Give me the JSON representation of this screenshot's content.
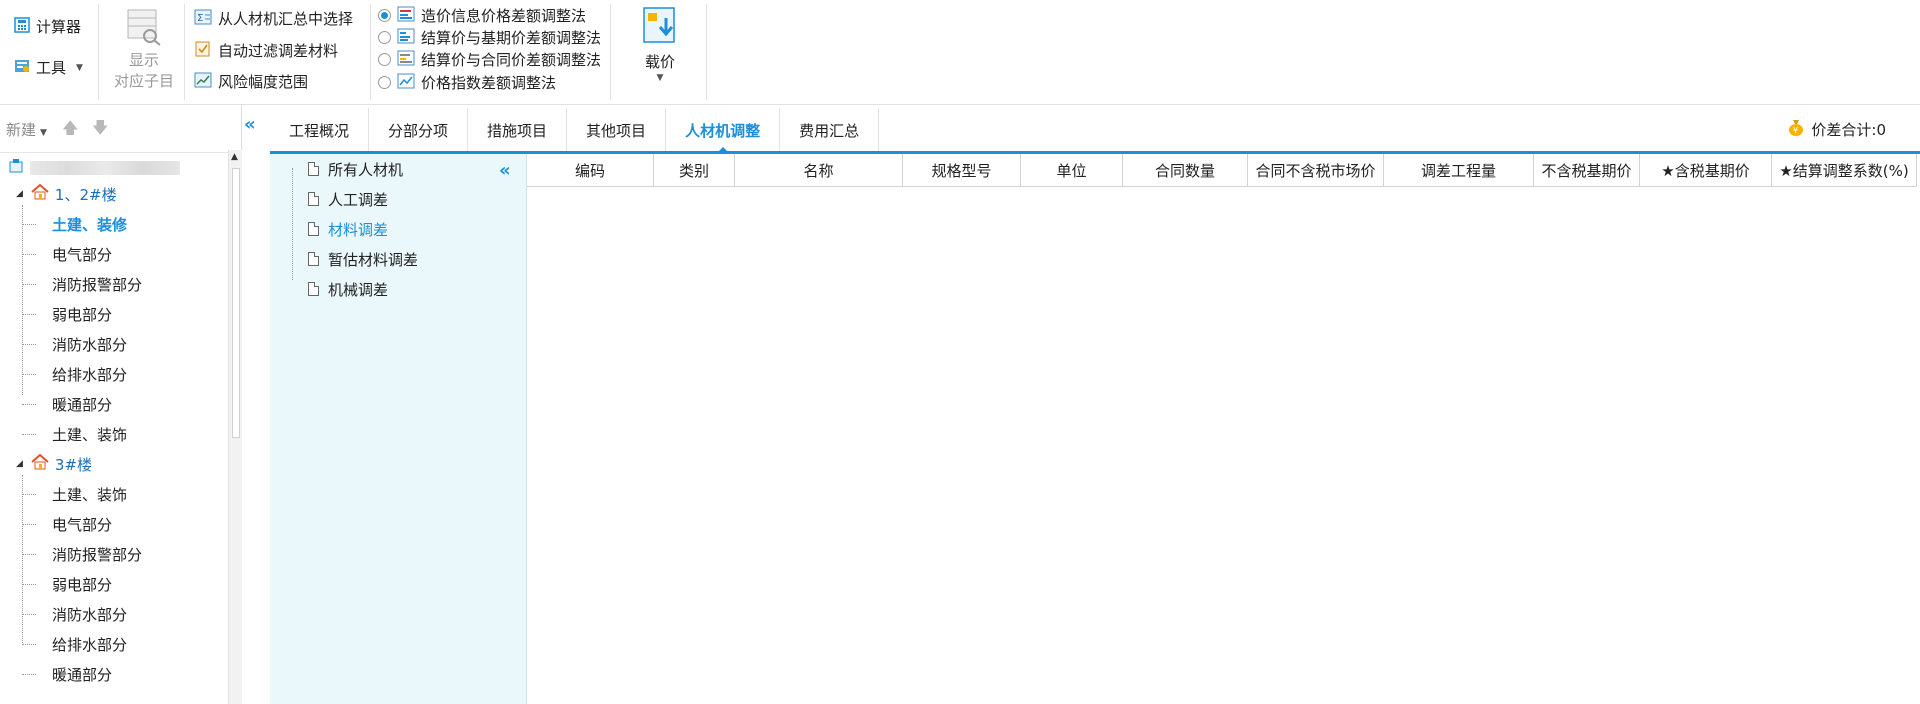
{
  "ribbon": {
    "calculator": "计算器",
    "tools": "工具",
    "show_sub_line1": "显示",
    "show_sub_line2": "对应子目",
    "select_from_summary": "从人材机汇总中选择",
    "auto_filter": "自动过滤调差材料",
    "risk_range": "风险幅度范围",
    "methods": [
      {
        "label": "造价信息价格差额调整法",
        "selected": true
      },
      {
        "label": "结算价与基期价差额调整法",
        "selected": false
      },
      {
        "label": "结算价与合同价差额调整法",
        "selected": false
      },
      {
        "label": "价格指数差额调整法",
        "selected": false
      }
    ],
    "load_price": "载价"
  },
  "tree_toolbar": {
    "new_label": "新建"
  },
  "tree": {
    "root_label": "",
    "building1": {
      "label": "1、2#楼",
      "children": [
        "土建、装修",
        "电气部分",
        "消防报警部分",
        "弱电部分",
        "消防水部分",
        "给排水部分",
        "暖通部分",
        "土建、装饰"
      ]
    },
    "building3": {
      "label": "3#楼",
      "children": [
        "土建、装饰",
        "电气部分",
        "消防报警部分",
        "弱电部分",
        "消防水部分",
        "给排水部分",
        "暖通部分"
      ]
    }
  },
  "tabs": [
    {
      "label": "工程概况",
      "active": false
    },
    {
      "label": "分部分项",
      "active": false
    },
    {
      "label": "措施项目",
      "active": false
    },
    {
      "label": "其他项目",
      "active": false
    },
    {
      "label": "人材机调整",
      "active": true
    },
    {
      "label": "费用汇总",
      "active": false
    }
  ],
  "price_diff_total": "价差合计:0",
  "sub_categories": [
    {
      "label": "所有人材机",
      "active": false
    },
    {
      "label": "人工调差",
      "active": false
    },
    {
      "label": "材料调差",
      "active": true
    },
    {
      "label": "暂估材料调差",
      "active": false
    },
    {
      "label": "机械调差",
      "active": false
    }
  ],
  "grid_columns": [
    "编码",
    "类别",
    "名称",
    "规格型号",
    "单位",
    "合同数量",
    "合同不含税市场价",
    "调差工程量",
    "不含税基期价",
    "★含税基期价",
    "★结算调整系数(%)"
  ],
  "colors": {
    "accent": "#1c8fd8",
    "sub_panel_bg": "#eaf8fb"
  }
}
